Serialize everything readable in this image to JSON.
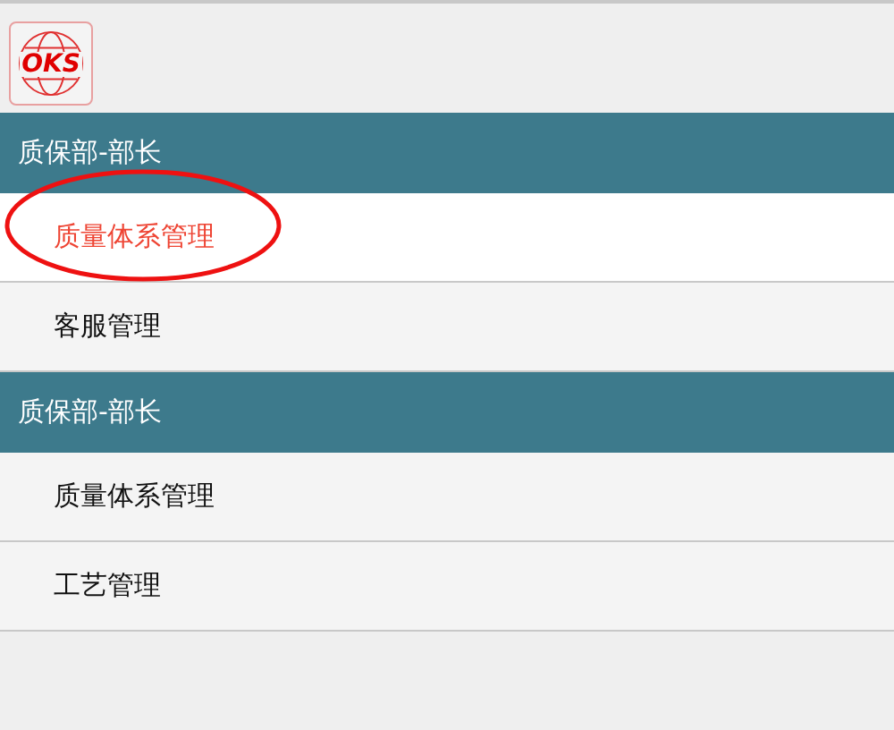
{
  "logo": {
    "text": "OKS"
  },
  "groups": [
    {
      "title": "质保部-部长",
      "items": [
        {
          "label": "质量体系管理",
          "selected": true,
          "circled": true
        },
        {
          "label": "客服管理",
          "selected": false,
          "circled": false
        }
      ]
    },
    {
      "title": "质保部-部长",
      "items": [
        {
          "label": "质量体系管理",
          "selected": false,
          "circled": false
        },
        {
          "label": "工艺管理",
          "selected": false,
          "circled": false
        }
      ]
    }
  ]
}
